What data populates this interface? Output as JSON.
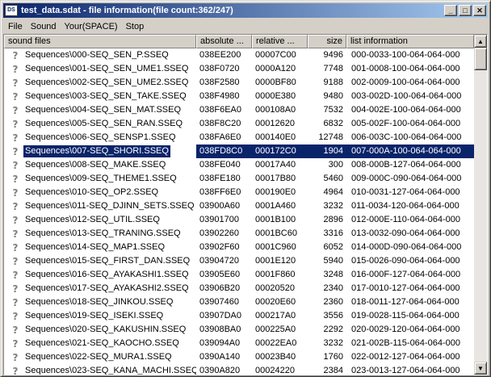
{
  "window": {
    "icon_text": "DS",
    "title": "test_data.sdat - file information(file count:362/247)",
    "minimize": "_",
    "maximize": "□",
    "close": "✕"
  },
  "menu": [
    "File",
    "Sound",
    "Your(SPACE)",
    "Stop"
  ],
  "columns": [
    "sound files",
    "absolute ...",
    "relative ...",
    "size",
    "list information"
  ],
  "selected_index": 7,
  "rows": [
    {
      "name": "Sequences\\000-SEQ_SEN_P.SSEQ",
      "abs": "038EE200",
      "rel": "00007C00",
      "size": "9496",
      "info": "000-0033-100-064-064-000"
    },
    {
      "name": "Sequences\\001-SEQ_SEN_UME1.SSEQ",
      "abs": "038F0720",
      "rel": "0000A120",
      "size": "7748",
      "info": "001-0008-100-064-064-000"
    },
    {
      "name": "Sequences\\002-SEQ_SEN_UME2.SSEQ",
      "abs": "038F2580",
      "rel": "0000BF80",
      "size": "9188",
      "info": "002-0009-100-064-064-000"
    },
    {
      "name": "Sequences\\003-SEQ_SEN_TAKE.SSEQ",
      "abs": "038F4980",
      "rel": "0000E380",
      "size": "9480",
      "info": "003-002D-100-064-064-000"
    },
    {
      "name": "Sequences\\004-SEQ_SEN_MAT.SSEQ",
      "abs": "038F6EA0",
      "rel": "000108A0",
      "size": "7532",
      "info": "004-002E-100-064-064-000"
    },
    {
      "name": "Sequences\\005-SEQ_SEN_RAN.SSEQ",
      "abs": "038F8C20",
      "rel": "00012620",
      "size": "6832",
      "info": "005-002F-100-064-064-000"
    },
    {
      "name": "Sequences\\006-SEQ_SENSP1.SSEQ",
      "abs": "038FA6E0",
      "rel": "000140E0",
      "size": "12748",
      "info": "006-003C-100-064-064-000"
    },
    {
      "name": "Sequences\\007-SEQ_SHORI.SSEQ",
      "abs": "038FD8C0",
      "rel": "000172C0",
      "size": "1904",
      "info": "007-000A-100-064-064-000"
    },
    {
      "name": "Sequences\\008-SEQ_MAKE.SSEQ",
      "abs": "038FE040",
      "rel": "00017A40",
      "size": "300",
      "info": "008-000B-127-064-064-000"
    },
    {
      "name": "Sequences\\009-SEQ_THEME1.SSEQ",
      "abs": "038FE180",
      "rel": "00017B80",
      "size": "5460",
      "info": "009-000C-090-064-064-000"
    },
    {
      "name": "Sequences\\010-SEQ_OP2.SSEQ",
      "abs": "038FF6E0",
      "rel": "000190E0",
      "size": "4964",
      "info": "010-0031-127-064-064-000"
    },
    {
      "name": "Sequences\\011-SEQ_DJINN_SETS.SSEQ",
      "abs": "03900A60",
      "rel": "0001A460",
      "size": "3232",
      "info": "011-0034-120-064-064-000"
    },
    {
      "name": "Sequences\\012-SEQ_UTIL.SSEQ",
      "abs": "03901700",
      "rel": "0001B100",
      "size": "2896",
      "info": "012-000E-110-064-064-000"
    },
    {
      "name": "Sequences\\013-SEQ_TRANING.SSEQ",
      "abs": "03902260",
      "rel": "0001BC60",
      "size": "3316",
      "info": "013-0032-090-064-064-000"
    },
    {
      "name": "Sequences\\014-SEQ_MAP1.SSEQ",
      "abs": "03902F60",
      "rel": "0001C960",
      "size": "6052",
      "info": "014-000D-090-064-064-000"
    },
    {
      "name": "Sequences\\015-SEQ_FIRST_DAN.SSEQ",
      "abs": "03904720",
      "rel": "0001E120",
      "size": "5940",
      "info": "015-0026-090-064-064-000"
    },
    {
      "name": "Sequences\\016-SEQ_AYAKASHI1.SSEQ",
      "abs": "03905E60",
      "rel": "0001F860",
      "size": "3248",
      "info": "016-000F-127-064-064-000"
    },
    {
      "name": "Sequences\\017-SEQ_AYAKASHI2.SSEQ",
      "abs": "03906B20",
      "rel": "00020520",
      "size": "2340",
      "info": "017-0010-127-064-064-000"
    },
    {
      "name": "Sequences\\018-SEQ_JINKOU.SSEQ",
      "abs": "03907460",
      "rel": "00020E60",
      "size": "2360",
      "info": "018-0011-127-064-064-000"
    },
    {
      "name": "Sequences\\019-SEQ_ISEKI.SSEQ",
      "abs": "03907DA0",
      "rel": "000217A0",
      "size": "3556",
      "info": "019-0028-115-064-064-000"
    },
    {
      "name": "Sequences\\020-SEQ_KAKUSHIN.SSEQ",
      "abs": "03908BA0",
      "rel": "000225A0",
      "size": "2292",
      "info": "020-0029-120-064-064-000"
    },
    {
      "name": "Sequences\\021-SEQ_KAOCHO.SSEQ",
      "abs": "039094A0",
      "rel": "00022EA0",
      "size": "3232",
      "info": "021-002B-115-064-064-000"
    },
    {
      "name": "Sequences\\022-SEQ_MURA1.SSEQ",
      "abs": "0390A140",
      "rel": "00023B40",
      "size": "1760",
      "info": "022-0012-127-064-064-000"
    },
    {
      "name": "Sequences\\023-SEQ_KANA_MACHI.SSEQ",
      "abs": "0390A820",
      "rel": "00024220",
      "size": "2384",
      "info": "023-0013-127-064-064-000"
    }
  ],
  "scrollbar": {
    "up": "▲",
    "down": "▼"
  }
}
